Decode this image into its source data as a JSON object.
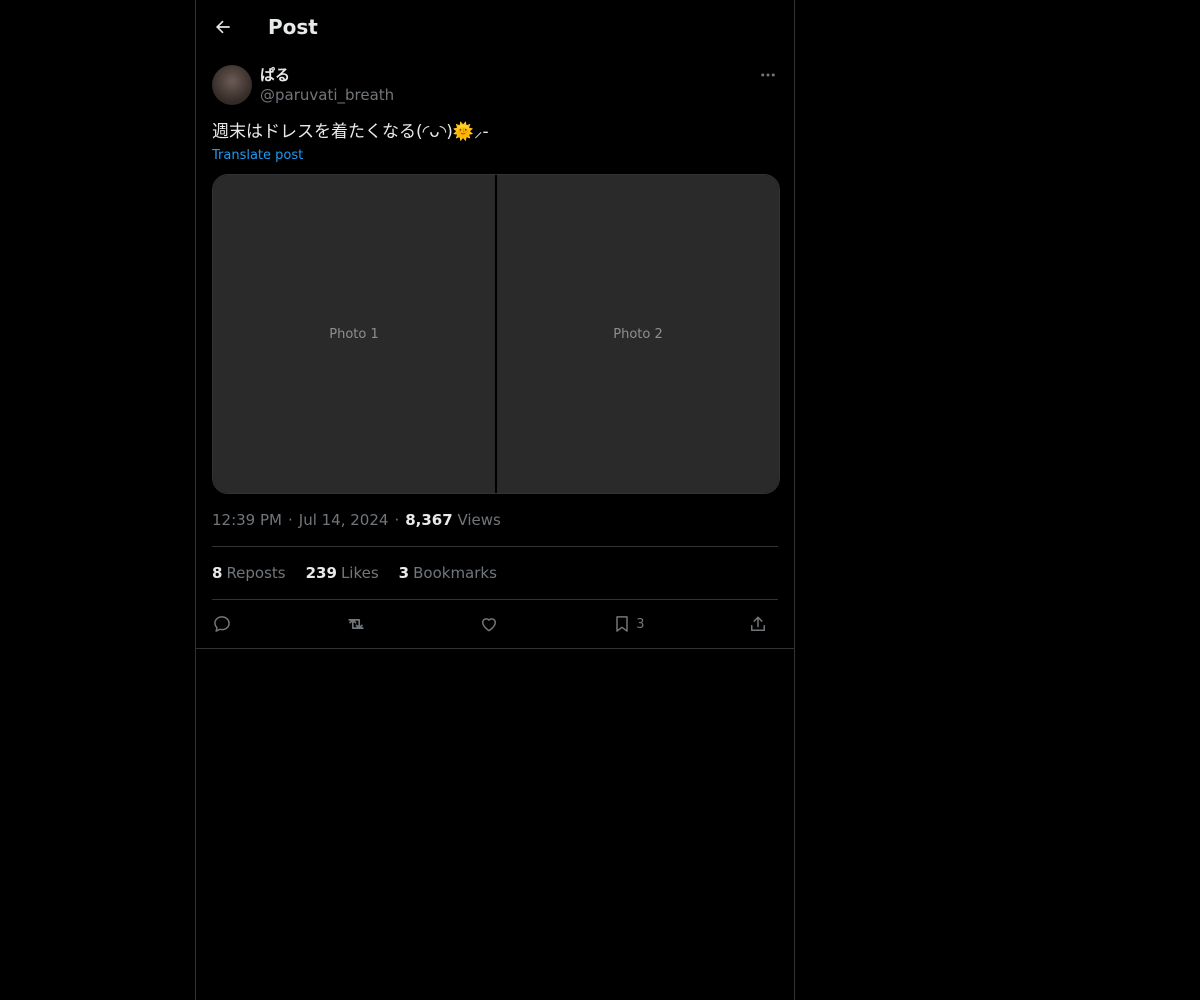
{
  "header": {
    "title": "Post"
  },
  "author": {
    "display_name": "ぱる",
    "handle": "@paruvati_breath"
  },
  "post": {
    "text": "週末はドレスを着たくなる(◜ᴗ◝)🌞⸝-",
    "translate_label": "Translate post",
    "media": [
      {
        "label": "Photo 1"
      },
      {
        "label": "Photo 2"
      }
    ]
  },
  "meta": {
    "time": "12:39 PM",
    "date": "Jul 14, 2024",
    "views_count": "8,367",
    "views_label": "Views"
  },
  "stats": {
    "reposts_count": "8",
    "reposts_label": "Reposts",
    "likes_count": "239",
    "likes_label": "Likes",
    "bookmarks_count": "3",
    "bookmarks_label": "Bookmarks"
  },
  "actions": {
    "bookmark_count": "3",
    "icons": [
      "reply-icon",
      "repost-icon",
      "like-icon",
      "bookmark-icon",
      "share-icon"
    ]
  },
  "colors": {
    "background": "#000000",
    "text": "#e7e9ea",
    "muted": "#71767b",
    "link": "#1d9bf0",
    "border": "#2f3336"
  }
}
